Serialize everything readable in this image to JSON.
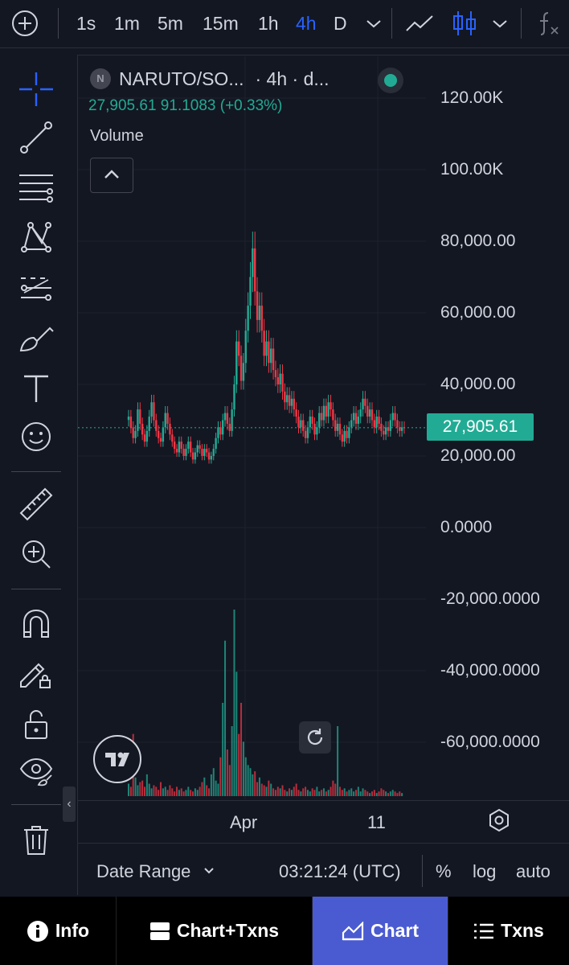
{
  "toolbar": {
    "intervals": [
      "1s",
      "1m",
      "5m",
      "15m",
      "1h",
      "4h",
      "D"
    ],
    "active_interval": "4h"
  },
  "legend": {
    "symbol_logo": "N",
    "symbol": "NARUTO/SO...",
    "meta": "· 4h · d...",
    "ohlc_text": "27,905.61  91.1083 (+0.33%)",
    "volume_label": "Volume",
    "status_color": "#22ab94"
  },
  "price_axis": {
    "labels": [
      "120.00K",
      "100.00K",
      "80,000.00",
      "60,000.00",
      "40,000.00",
      "20,000.00",
      "0.0000",
      "-20,000.0000",
      "-40,000.0000",
      "-60,000.0000"
    ],
    "last_price": "27,905.61"
  },
  "time_axis": {
    "labels": [
      "Apr",
      "11"
    ]
  },
  "bottom_bar": {
    "date_range": "Date Range",
    "time": "03:21:24 (UTC)",
    "percent": "%",
    "log": "log",
    "auto": "auto"
  },
  "nav": {
    "info": "Info",
    "chart_txns": "Chart+Txns",
    "chart": "Chart",
    "txns": "Txns"
  },
  "colors": {
    "up": "#22ab94",
    "down": "#f23645",
    "accent": "#2962ff",
    "nav_active": "#4a5bd1"
  },
  "chart_data": {
    "type": "candlestick",
    "interval": "4h",
    "ylim": [
      -70000,
      130000
    ],
    "price_ticks": [
      120000,
      100000,
      80000,
      60000,
      40000,
      20000,
      0,
      -20000,
      -40000,
      -60000
    ],
    "last_price": 27905.61,
    "x_labels": [
      "Apr",
      "11"
    ],
    "close": [
      31000,
      28000,
      25000,
      27000,
      33000,
      29000,
      26000,
      24000,
      27000,
      31000,
      35000,
      30000,
      27000,
      25000,
      24000,
      28000,
      32000,
      29000,
      26000,
      24000,
      22000,
      21000,
      24000,
      22000,
      20000,
      22000,
      24000,
      21000,
      19000,
      21000,
      23000,
      22000,
      20000,
      22000,
      21000,
      19000,
      20000,
      22000,
      25000,
      28000,
      26000,
      30000,
      32000,
      29000,
      27000,
      33000,
      40000,
      52000,
      48000,
      41000,
      46000,
      55000,
      62000,
      70000,
      78000,
      66000,
      58000,
      62000,
      55000,
      48000,
      52000,
      46000,
      50000,
      44000,
      42000,
      40000,
      43000,
      38000,
      35000,
      37000,
      34000,
      36000,
      33000,
      31000,
      28000,
      30000,
      27000,
      25000,
      28000,
      31000,
      29000,
      26000,
      28000,
      32000,
      30000,
      34000,
      31000,
      35000,
      33000,
      30000,
      27000,
      29000,
      26000,
      24000,
      27000,
      25000,
      28000,
      30000,
      32000,
      29000,
      31000,
      33000,
      36000,
      34000,
      31000,
      33000,
      30000,
      28000,
      31000,
      29000,
      27000,
      26000,
      28000,
      27000,
      30000,
      32000,
      30000,
      28000,
      27000,
      28000,
      27905.61
    ],
    "volume": [
      8,
      6,
      40,
      12,
      7,
      9,
      10,
      6,
      14,
      8,
      5,
      7,
      6,
      4,
      9,
      5,
      6,
      4,
      7,
      5,
      3,
      6,
      4,
      5,
      3,
      4,
      6,
      4,
      3,
      5,
      4,
      6,
      9,
      12,
      7,
      5,
      14,
      18,
      10,
      8,
      25,
      60,
      100,
      30,
      20,
      45,
      120,
      80,
      40,
      60,
      35,
      25,
      20,
      18,
      14,
      16,
      9,
      12,
      8,
      7,
      6,
      10,
      8,
      5,
      4,
      6,
      5,
      7,
      4,
      3,
      5,
      4,
      6,
      8,
      4,
      3,
      5,
      6,
      4,
      3,
      5,
      4,
      6,
      3,
      4,
      5,
      3,
      4,
      6,
      10,
      8,
      45,
      6,
      4,
      5,
      3,
      4,
      5,
      3,
      4,
      6,
      3,
      5,
      4,
      3,
      2,
      3,
      4,
      2,
      3,
      5,
      4,
      3,
      2,
      3,
      4,
      3,
      2,
      3,
      2
    ]
  }
}
